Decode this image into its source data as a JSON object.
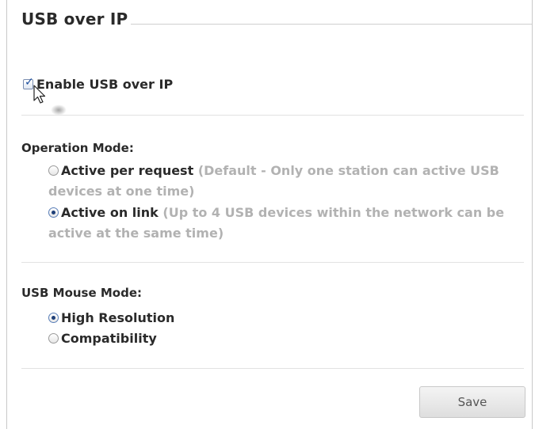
{
  "section": {
    "title": "USB over IP"
  },
  "enable": {
    "label": "Enable USB over IP",
    "checked": true
  },
  "operation_mode": {
    "title": "Operation Mode:",
    "options": [
      {
        "label": "Active per request",
        "description": "(Default - Only one station can active USB devices at one time)",
        "selected": false
      },
      {
        "label": "Active on link",
        "description": "(Up to 4 USB devices within the network can be active at the same time)",
        "selected": true
      }
    ]
  },
  "mouse_mode": {
    "title": "USB Mouse Mode:",
    "options": [
      {
        "label": "High Resolution",
        "selected": true
      },
      {
        "label": "Compatibility",
        "selected": false
      }
    ]
  },
  "actions": {
    "save_label": "Save"
  },
  "colors": {
    "selected_radio_dot": "#1e3f78",
    "description_text": "#b2b2b2",
    "heading_text": "#2a2a2a"
  }
}
